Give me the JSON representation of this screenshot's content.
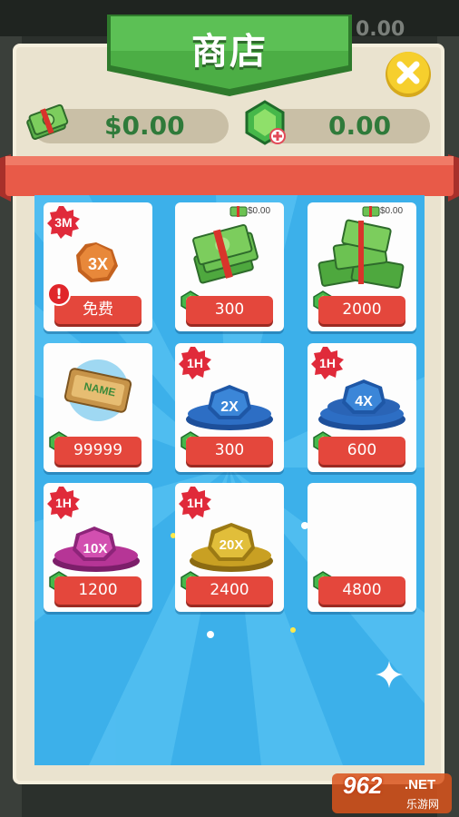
{
  "background": {
    "top_value": "0.00"
  },
  "header": {
    "title": "商店",
    "close_icon": "close-x-icon"
  },
  "currency": {
    "cash": "$0.00",
    "gems": "0.00"
  },
  "items": [
    {
      "badge": "3M",
      "art_label": "3X",
      "art": "orange-boost-token",
      "price": "免费",
      "alert": "!",
      "price_icon": null
    },
    {
      "badge": null,
      "art": "cash-stack-small",
      "top_price": "$0.00",
      "price": "300",
      "price_icon": "gem-icon"
    },
    {
      "badge": null,
      "art": "cash-stack-large",
      "top_price": "$0.00",
      "price": "2000",
      "price_icon": "gem-icon"
    },
    {
      "badge": null,
      "art": "name-tag-sign",
      "art_label": "NAME",
      "price": "99999",
      "price_icon": "gem-icon"
    },
    {
      "badge": "1H",
      "art": "blue-boost-token",
      "art_label": "2X",
      "price": "300",
      "price_icon": "gem-icon"
    },
    {
      "badge": "1H",
      "art": "blue-boost-token",
      "art_label": "4X",
      "price": "600",
      "price_icon": "gem-icon"
    },
    {
      "badge": "1H",
      "art": "pink-boost-token",
      "art_label": "10X",
      "price": "1200",
      "price_icon": "gem-icon"
    },
    {
      "badge": "1H",
      "art": "gold-boost-token",
      "art_label": "20X",
      "price": "2400",
      "price_icon": "gem-icon"
    },
    {
      "badge": null,
      "art": null,
      "price": "4800",
      "price_icon": "gem-icon"
    }
  ],
  "watermark": {
    "number": "962",
    "suffix": ".NET",
    "cn": "乐游网"
  },
  "colors": {
    "panel": "#eae3cf",
    "shop_bg": "#3fb3ec",
    "buy_button": "#e4473c",
    "title_green": "#4cae45",
    "ribbon": "#e85a48",
    "cash_text": "#2f7a3a"
  }
}
